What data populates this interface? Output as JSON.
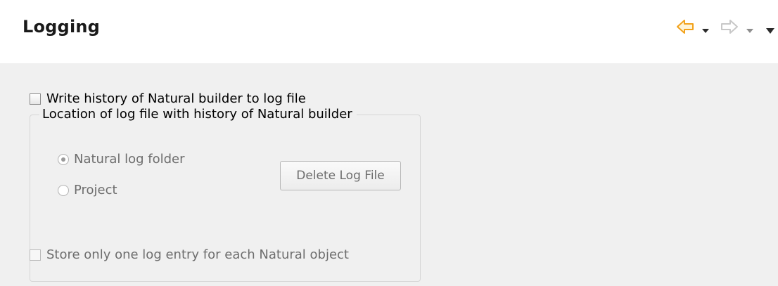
{
  "header": {
    "title": "Logging",
    "back_icon": "back-arrow-icon",
    "forward_icon": "forward-arrow-icon",
    "colors": {
      "back_arrow": "#f2a21b",
      "disabled_arrow": "#c8c8c8",
      "caret": "#2b2b2b"
    }
  },
  "options": {
    "write_history": {
      "label": "Write history of Natural builder to log file",
      "checked": false,
      "enabled": true
    },
    "location_group": {
      "title": "Location of log file with history of Natural builder",
      "radios": [
        {
          "label": "Natural log folder",
          "selected": true,
          "enabled": false
        },
        {
          "label": "Project",
          "selected": false,
          "enabled": false
        }
      ],
      "delete_button": {
        "label": "Delete Log File",
        "enabled": false
      }
    },
    "store_one_entry": {
      "label": "Store only one log entry for each Natural object",
      "checked": false,
      "enabled": false
    }
  }
}
